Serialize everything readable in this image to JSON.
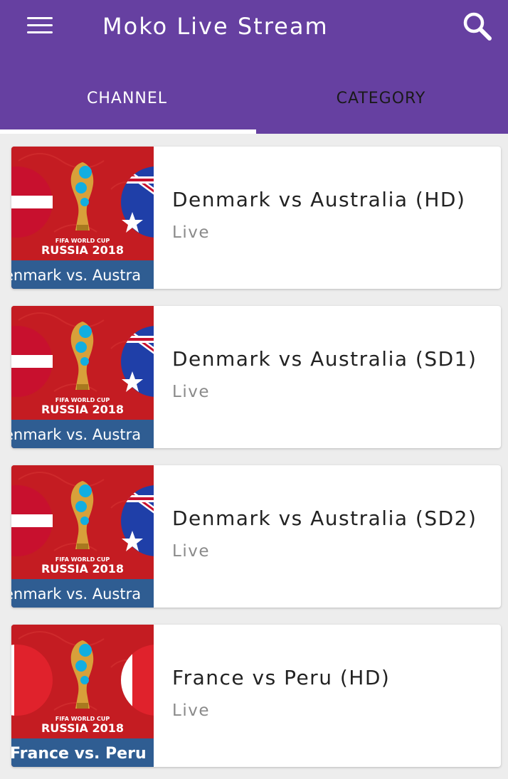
{
  "app": {
    "title": "Moko Live Stream",
    "menu_icon": "hamburger-menu-icon",
    "search_icon": "search-icon",
    "accent_color": "#6640a1"
  },
  "tabs": [
    {
      "label": "CHANNEL",
      "selected": true
    },
    {
      "label": "CATEGORY",
      "selected": false
    }
  ],
  "channels": [
    {
      "title": "Denmark vs Australia (HD)",
      "status": "Live",
      "thumb": {
        "caption": "enmark vs. Austra",
        "event": "FIFA WORLD CUP",
        "edition": "RUSSIA 2018",
        "left_flag": "denmark",
        "right_flag": "australia"
      }
    },
    {
      "title": "Denmark vs Australia (SD1)",
      "status": "Live",
      "thumb": {
        "caption": "enmark vs. Austra",
        "event": "FIFA WORLD CUP",
        "edition": "RUSSIA 2018",
        "left_flag": "denmark",
        "right_flag": "australia"
      }
    },
    {
      "title": "Denmark vs Australia (SD2)",
      "status": "Live",
      "thumb": {
        "caption": "enmark vs. Austra",
        "event": "FIFA WORLD CUP",
        "edition": "RUSSIA 2018",
        "left_flag": "denmark",
        "right_flag": "australia"
      }
    },
    {
      "title": "France vs Peru (HD)",
      "status": "Live",
      "thumb": {
        "caption": "France vs. Peru",
        "event": "FIFA WORLD CUP",
        "edition": "RUSSIA 2018",
        "left_flag": "france",
        "right_flag": "peru"
      }
    }
  ]
}
